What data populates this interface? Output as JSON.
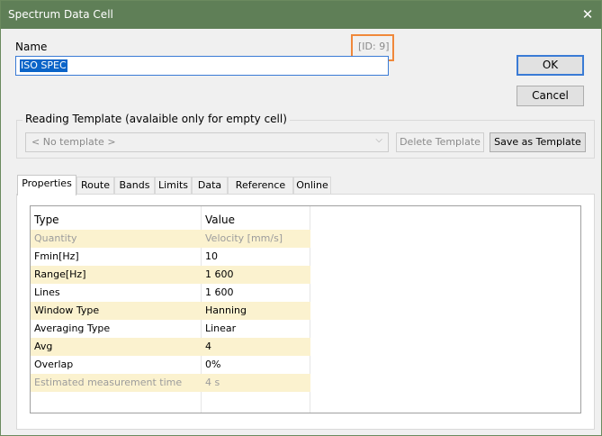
{
  "window": {
    "title": "Spectrum Data Cell",
    "close_glyph": "✕"
  },
  "name": {
    "label": "Name",
    "value": "ISO SPEC",
    "id_text": "[ID: 9]"
  },
  "buttons": {
    "ok": "OK",
    "cancel": "Cancel"
  },
  "template": {
    "group_label": "Reading Template (avalaible only for empty cell)",
    "combo_value": "< No template >",
    "combo_arrow": "⌵",
    "delete_label": "Delete Template",
    "save_label": "Save as Template"
  },
  "tabs": [
    {
      "label": "Properties",
      "active": true
    },
    {
      "label": "Route"
    },
    {
      "label": "Bands"
    },
    {
      "label": "Limits"
    },
    {
      "label": "Data"
    },
    {
      "label": "Reference"
    },
    {
      "label": "Online"
    }
  ],
  "grid": {
    "headers": {
      "type": "Type",
      "value": "Value"
    },
    "rows": [
      {
        "type": "Quantity",
        "value": "Velocity [mm/s]",
        "style": "yellow grey"
      },
      {
        "type": "Fmin[Hz]",
        "value": "10",
        "style": ""
      },
      {
        "type": "Range[Hz]",
        "value": "1 600",
        "style": "yellow"
      },
      {
        "type": "Lines",
        "value": "1 600",
        "style": ""
      },
      {
        "type": "Window Type",
        "value": "Hanning",
        "style": "yellow"
      },
      {
        "type": "Averaging Type",
        "value": "Linear",
        "style": ""
      },
      {
        "type": "Avg",
        "value": "4",
        "style": "yellow"
      },
      {
        "type": "Overlap",
        "value": "0%",
        "style": ""
      },
      {
        "type": "Estimated measurement time",
        "value": "4 s",
        "style": "yellow grey"
      }
    ]
  },
  "colors": {
    "titlebar": "#5f7f57",
    "highlight_row": "#fbf2cf",
    "id_box": "#f0883a",
    "selection": "#0a64c8"
  }
}
